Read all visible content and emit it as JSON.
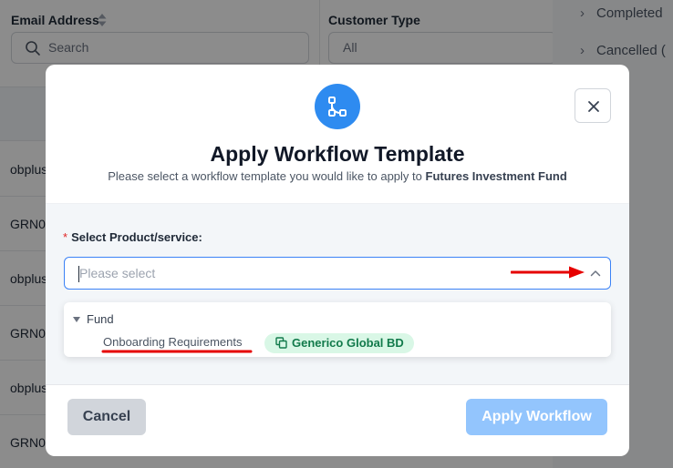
{
  "background": {
    "filters": [
      {
        "label": "Email Address",
        "placeholder": "Search"
      },
      {
        "label": "Customer Type",
        "value": "All"
      }
    ],
    "rows": [
      "obplus",
      "GRN0",
      "obplus",
      "GRN0",
      "obplus",
      "GRN0"
    ],
    "side_items": [
      "Completed",
      "Cancelled ("
    ]
  },
  "modal": {
    "icon": "workflow-branch-icon",
    "title": "Apply Workflow Template",
    "subtitle_prefix": "Please select a workflow template you would like to apply to",
    "subtitle_target": "Futures Investment Fund",
    "field": {
      "required_mark": "*",
      "label": "Select Product/service:",
      "placeholder": "Please select"
    },
    "dropdown": {
      "group": "Fund",
      "item": "Onboarding Requirements",
      "tag": "Generico Global BD",
      "tag_icon": "copy-icon"
    },
    "buttons": {
      "cancel": "Cancel",
      "apply": "Apply Workflow"
    },
    "colors": {
      "accent": "#2e8bf0",
      "apply_disabled": "#93c5fd",
      "tag_bg": "#d9f7e6",
      "tag_text": "#127a4b",
      "annotation": "#e60000"
    }
  }
}
